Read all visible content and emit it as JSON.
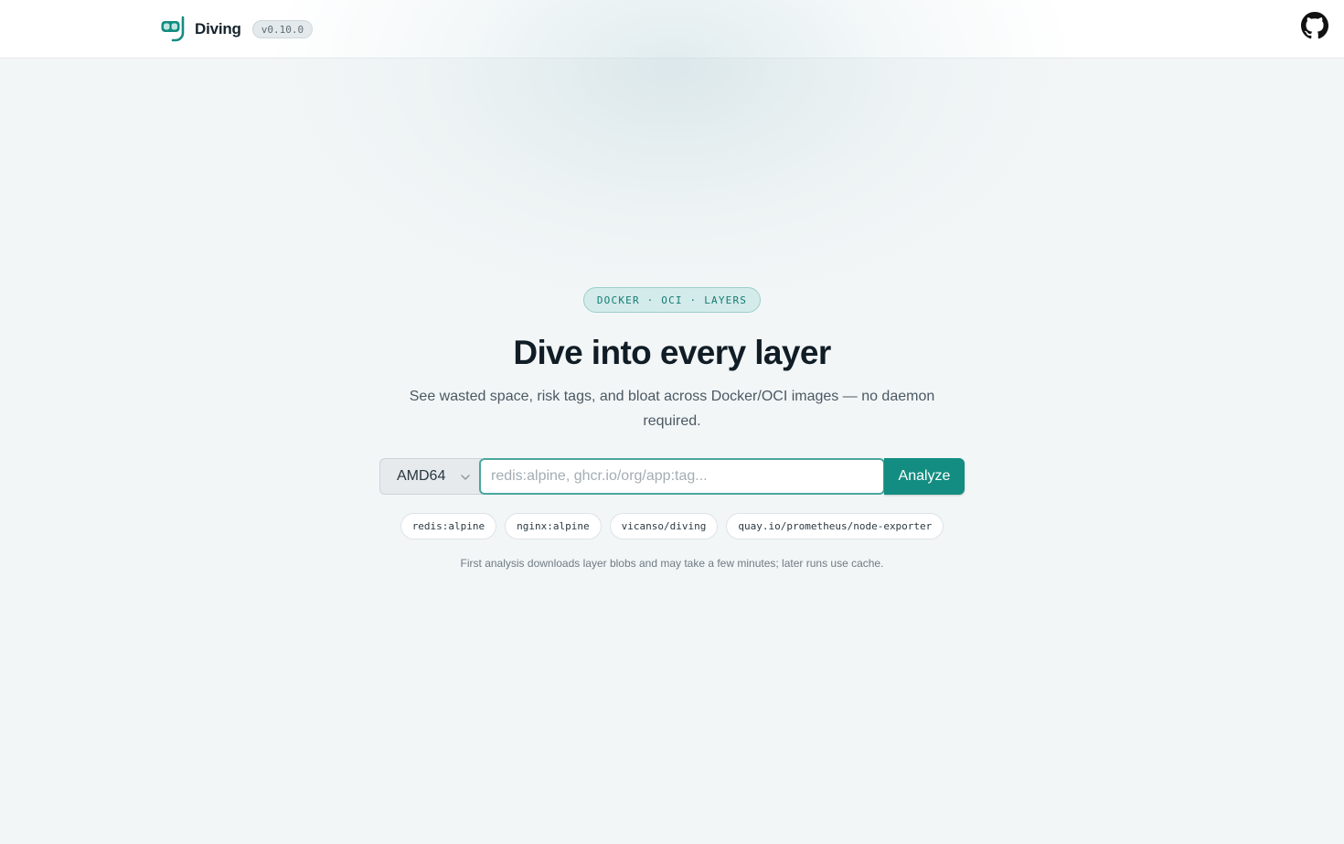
{
  "header": {
    "brand_name": "Diving",
    "version": "v0.10.0",
    "logo_icon": "diving-mask-snorkel-icon",
    "github_icon": "github-icon",
    "brand_color": "#138d81"
  },
  "hero": {
    "pill": "DOCKER · OCI · LAYERS",
    "title": "Dive into every layer",
    "subtitle": "See wasted space, risk tags, and bloat across Docker/OCI images — no daemon required."
  },
  "search": {
    "arch_selected": "AMD64",
    "input_value": "",
    "input_placeholder": "redis:alpine, ghcr.io/org/app:tag...",
    "submit_label": "Analyze"
  },
  "examples": [
    "redis:alpine",
    "nginx:alpine",
    "vicanso/diving",
    "quay.io/prometheus/node-exporter"
  ],
  "note": "First analysis downloads layer blobs and may take a few minutes; later runs use cache."
}
